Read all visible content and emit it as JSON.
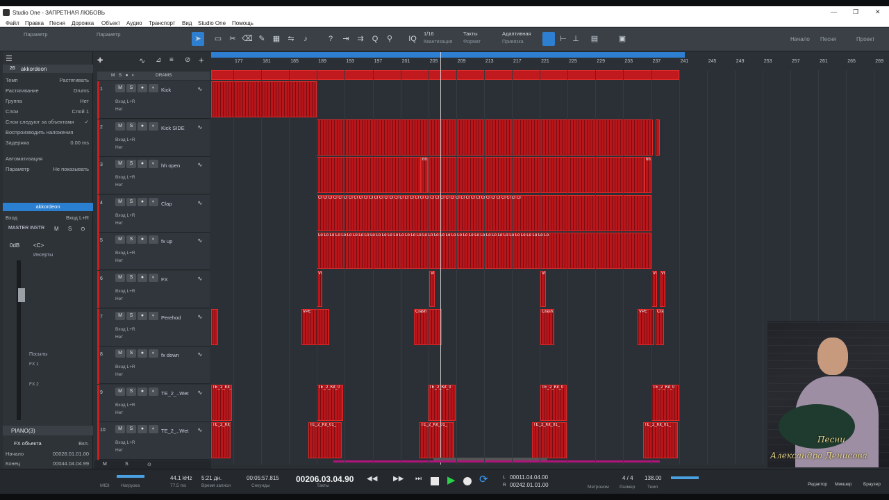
{
  "titlebar": {
    "title": "Studio One - ЗАПРЕТНАЯ ЛЮБОВЬ"
  },
  "menu": [
    "Файл",
    "Правка",
    "Песня",
    "Дорожка",
    "Объект",
    "Аудио",
    "Транспорт",
    "Вид",
    "Studio One",
    "Помощь"
  ],
  "toolbar": {
    "param1": "Параметр",
    "param2": "Параметр",
    "quant_value": "1/16",
    "quant_label": "Квантизация",
    "timebase_value": "Такты",
    "timebase_label": "Формат",
    "snap_value": "Адаптивная",
    "snap_label": "Привязка",
    "start": "Начало",
    "song": "Песня",
    "project": "Проект"
  },
  "inspector": {
    "track_num": "26",
    "track_name": "akkordeon",
    "rows": [
      {
        "k": "Темп",
        "v": "Растягивать"
      },
      {
        "k": "Растягивание",
        "v": "Drums"
      },
      {
        "k": "Группа",
        "v": "Нет"
      },
      {
        "k": "Слои",
        "v": "Слой 1"
      },
      {
        "k": "Слои следуют за объектами",
        "v": "✓"
      },
      {
        "k": "Воспроизводить наложения",
        "v": ""
      },
      {
        "k": "Задержка",
        "v": "0.00 ms"
      }
    ],
    "automation": "Автоматизация",
    "param": "Параметр",
    "param_value": "Не показывать",
    "channel_name": "akkordeon",
    "input_label": "Вход",
    "input_value": "Вход L+R",
    "master": "MASTER INSTR",
    "vol": "0dB",
    "pan": "<C>",
    "inserts": "Инсерты",
    "sends": "Посылы",
    "fx1": "FX 1",
    "fx2": "FX 2",
    "piano": "PIANO(3)",
    "fx_obj": "FX объекта",
    "fx_obj_val": "Вкл.",
    "start_label": "Начало",
    "start_val": "00028.01.01.00",
    "end_label": "Конец",
    "end_val": "00044.04.04.99"
  },
  "folder": {
    "label": "DRAMS"
  },
  "tracks": [
    {
      "num": "1",
      "name": "Kick",
      "input": "Вход L+R",
      "out": "Нет"
    },
    {
      "num": "2",
      "name": "Kick SIDE",
      "input": "Вход L+R",
      "out": "Нет"
    },
    {
      "num": "3",
      "name": "hh open",
      "input": "Вход L+R",
      "out": "Нет"
    },
    {
      "num": "4",
      "name": "Clap",
      "input": "Вход L+R",
      "out": "Нет"
    },
    {
      "num": "5",
      "name": "fx up",
      "input": "Вход L+R",
      "out": "Нет"
    },
    {
      "num": "6",
      "name": "FX",
      "input": "Вход L+R",
      "out": "Нет"
    },
    {
      "num": "7",
      "name": "Perehod",
      "input": "Вход L+R",
      "out": "Нет"
    },
    {
      "num": "8",
      "name": "fx down",
      "input": "Вход L+R",
      "out": "Нет"
    },
    {
      "num": "9",
      "name": "TE_2_..Wet",
      "input": "Вход L+R",
      "out": "Нет"
    },
    {
      "num": "10",
      "name": "TE_2_..Wet",
      "input": "Вход L+R",
      "out": "Нет"
    }
  ],
  "ruler": [
    "177",
    "181",
    "185",
    "189",
    "193",
    "197",
    "201",
    "205",
    "209",
    "213",
    "217",
    "221",
    "225",
    "229",
    "233",
    "237",
    "241",
    "245",
    "249",
    "253",
    "257",
    "261",
    "265",
    "269"
  ],
  "clip_labels": {
    "hh": "hh",
    "cl": "Cl Cl Cl Cl Cl Cl Cl Cl Cl Cl Cl Cl Cl Cl Cl Cl Cl Cl Cl Cl Cl Cl Cl Cl Cl Cl Cl Cl Cl Cl Cl Cl Cl Cl Cl Cl Cl Cl Cl Cl",
    "lo": "Lo Lo Lo Lo Lo Lo Lo Lo Lo Lo Lo Lo Lo Lo Lo Lo Lo Lo Lo Lo Lo Lo Lo Lo Lo Lo Lo Lo Lo Lo Lo Lo Lo Lo Lo Lo Lo Lo Lo Lo",
    "vp": "VP",
    "crash": "Crash",
    "vpe": "VPE",
    "te_kit_a": "TE_2_Kit_0",
    "te_kit_b": "TE_2_Kit_01_"
  },
  "transport": {
    "midi": "MIDI",
    "load": "Нагрузка",
    "rate": "44.1 kHz",
    "latency": "77.5 ms",
    "rec_time": "5:21 дн.",
    "rec_label": "Время записи",
    "seconds_val": "00:05:57.815",
    "seconds_label": "Секунды",
    "bars_val": "00206.03.04.90",
    "bars_label": "Такты",
    "loop_l": "00011.04.04.00",
    "loop_r": "00242.01.01.00",
    "metronome": "Метроном",
    "sig": "4 / 4",
    "sig_label": "Размер",
    "tempo": "138.00",
    "tempo_label": "Темп",
    "editor": "Редактор",
    "mixer": "Микшер",
    "browser": "Браузер"
  },
  "webcam": {
    "line1": "Песни",
    "line2": "Александра Денисова"
  }
}
